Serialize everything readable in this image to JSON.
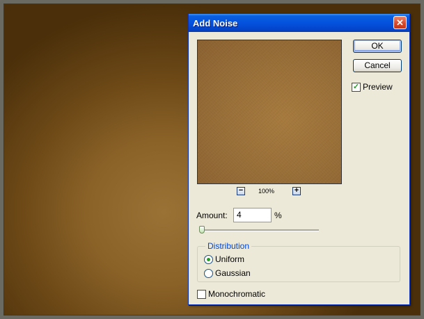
{
  "dialog": {
    "title": "Add Noise",
    "close_icon": "close-icon"
  },
  "preview": {
    "zoom_minus": "−",
    "zoom_plus": "+",
    "zoom_level": "100%"
  },
  "buttons": {
    "ok_label": "OK",
    "cancel_label": "Cancel"
  },
  "options": {
    "preview_label": "Preview",
    "preview_checked": true,
    "check_mark": "✓"
  },
  "amount": {
    "label": "Amount:",
    "value": "4",
    "unit": "%",
    "slider_fraction": 0.01
  },
  "distribution": {
    "group_title": "Distribution",
    "uniform_label": "Uniform",
    "gaussian_label": "Gaussian",
    "selected": "Uniform"
  },
  "monochromatic": {
    "label": "Monochromatic",
    "checked": false
  },
  "colors": {
    "title_bar": "#0452de",
    "dialog_bg": "#ece9d8",
    "close_button": "#d2472a",
    "preview_fill": "#9a7038",
    "group_title": "#0046d5"
  }
}
